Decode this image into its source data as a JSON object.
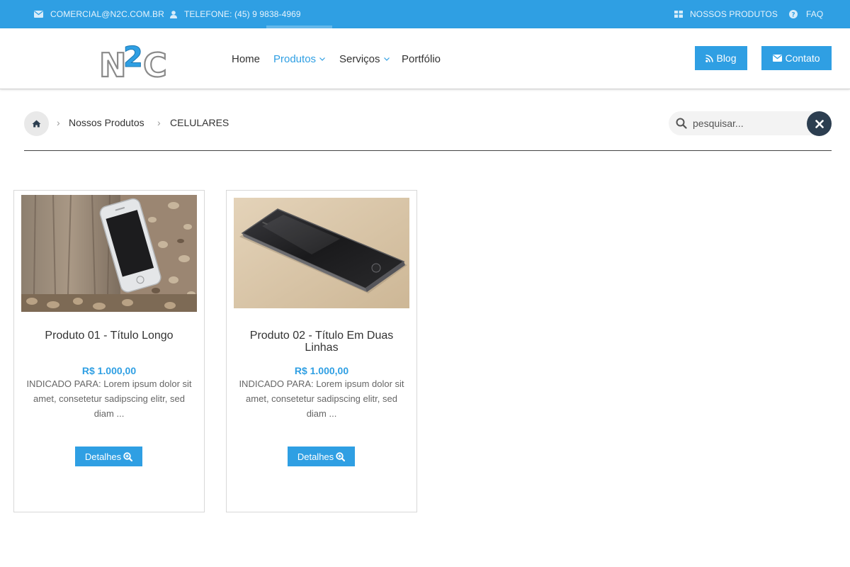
{
  "topbar": {
    "email": "COMERCIAL@N2C.COM.BR",
    "phone": "TELEFONE: (45) 9 9838-4969",
    "products_link": "NOSSOS PRODUTOS",
    "faq_link": "FAQ"
  },
  "header": {
    "logo_text": "N2C",
    "nav": [
      {
        "label": "Home"
      },
      {
        "label": "Produtos"
      },
      {
        "label": "Serviços"
      },
      {
        "label": "Portfólio"
      }
    ],
    "blog_label": "Blog",
    "contato_label": "Contato"
  },
  "breadcrumb": {
    "items": [
      "Nossos Produtos",
      "CELULARES"
    ]
  },
  "search": {
    "placeholder": "pesquisar..."
  },
  "products": [
    {
      "title": "Produto 01 - Título Longo",
      "price": "R$ 1.000,00",
      "description": "INDICADO PARA: Lorem ipsum dolor sit amet, consetetur sadipscing elitr, sed diam ...",
      "button_label": "Detalhes"
    },
    {
      "title": "Produto 02 - Título Em Duas Linhas",
      "price": "R$ 1.000,00",
      "description": "INDICADO PARA: Lorem ipsum dolor sit amet, consetetur sadipscing elitr, sed diam ...",
      "button_label": "Detalhes"
    }
  ],
  "colors": {
    "primary": "#2f9fe3",
    "dark": "#2c3e50"
  }
}
